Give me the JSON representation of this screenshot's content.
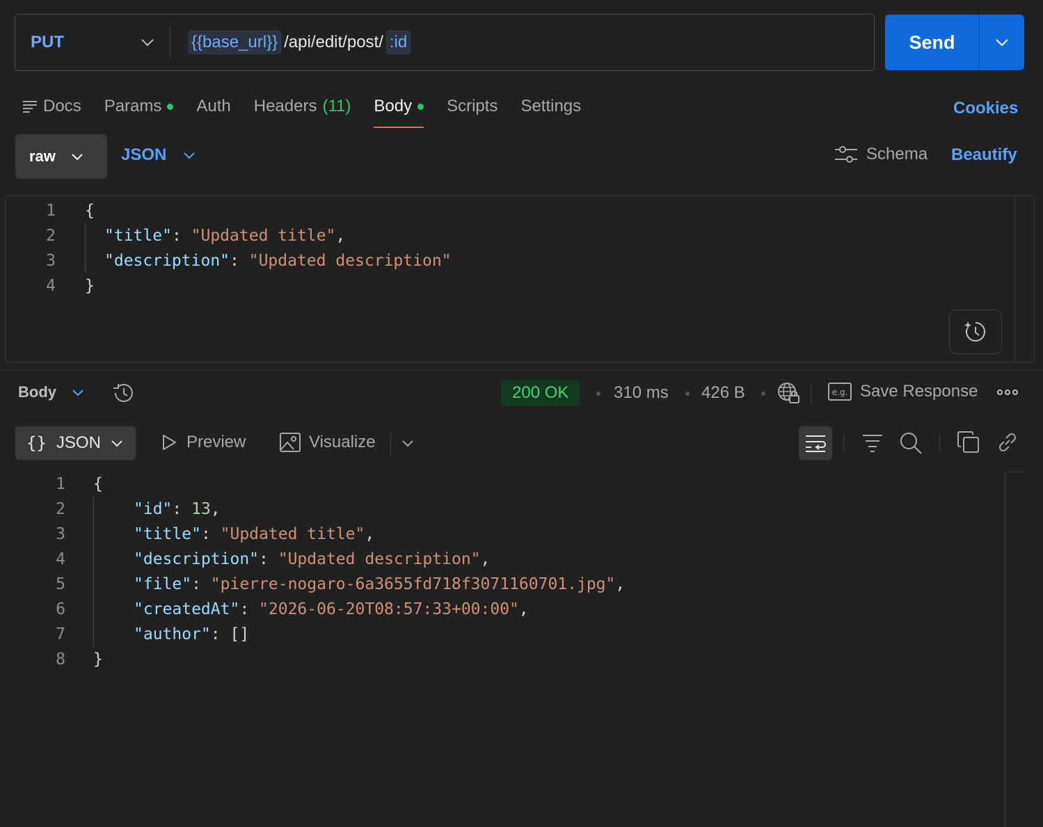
{
  "request": {
    "method": "PUT",
    "url_var": "{{base_url}}",
    "url_path": "/api/edit/post/",
    "url_param": ":id",
    "send_label": "Send"
  },
  "tabs": {
    "docs": "Docs",
    "params": "Params",
    "auth": "Auth",
    "headers": "Headers",
    "headers_count": "(11)",
    "body": "Body",
    "scripts": "Scripts",
    "settings": "Settings",
    "cookies": "Cookies"
  },
  "body_mode": {
    "raw": "raw",
    "json": "JSON",
    "schema": "Schema",
    "beautify": "Beautify"
  },
  "request_body": {
    "lines": [
      {
        "n": "1",
        "text": "{"
      },
      {
        "n": "2",
        "key": "\"title\"",
        "value": "\"Updated title\"",
        "trail": ","
      },
      {
        "n": "3",
        "key": "\"description\"",
        "value": "\"Updated description\"",
        "trail": ""
      },
      {
        "n": "4",
        "text": "}"
      }
    ]
  },
  "response": {
    "body_label": "Body",
    "status": "200 OK",
    "time": "310 ms",
    "size": "426 B",
    "save_response": "Save Response",
    "format": "JSON",
    "preview": "Preview",
    "visualize": "Visualize",
    "eg_label": "e.g."
  },
  "response_body": {
    "line_numbers": [
      "1",
      "2",
      "3",
      "4",
      "5",
      "6",
      "7",
      "8"
    ],
    "open": "{",
    "close": "}",
    "id_key": "\"id\"",
    "id_val": "13",
    "title_key": "\"title\"",
    "title_val": "\"Updated title\"",
    "desc_key": "\"description\"",
    "desc_val": "\"Updated description\"",
    "file_key": "\"file\"",
    "file_val": "\"pierre-nogaro-6a3655fd718f3071160701.jpg\"",
    "created_key": "\"createdAt\"",
    "created_val": "\"2026-06-20T08:57:33+00:00\"",
    "author_key": "\"author\"",
    "author_val": "[]"
  },
  "colors": {
    "accent_blue": "#0f6ad9",
    "link_blue": "#5aa0ff",
    "active_tab_underline": "#ff6c37",
    "status_green": "#47d07a",
    "json_key": "#9cdcfe",
    "json_string": "#ce9178",
    "json_number": "#b5cea8"
  }
}
